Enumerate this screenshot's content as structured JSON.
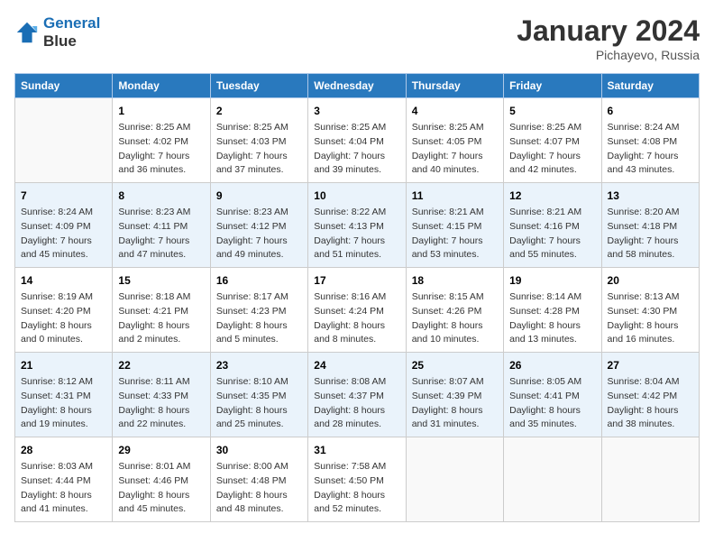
{
  "header": {
    "logo_line1": "General",
    "logo_line2": "Blue",
    "month": "January 2024",
    "location": "Pichayevo, Russia"
  },
  "columns": [
    "Sunday",
    "Monday",
    "Tuesday",
    "Wednesday",
    "Thursday",
    "Friday",
    "Saturday"
  ],
  "weeks": [
    [
      {
        "day": "",
        "info": ""
      },
      {
        "day": "1",
        "info": "Sunrise: 8:25 AM\nSunset: 4:02 PM\nDaylight: 7 hours\nand 36 minutes."
      },
      {
        "day": "2",
        "info": "Sunrise: 8:25 AM\nSunset: 4:03 PM\nDaylight: 7 hours\nand 37 minutes."
      },
      {
        "day": "3",
        "info": "Sunrise: 8:25 AM\nSunset: 4:04 PM\nDaylight: 7 hours\nand 39 minutes."
      },
      {
        "day": "4",
        "info": "Sunrise: 8:25 AM\nSunset: 4:05 PM\nDaylight: 7 hours\nand 40 minutes."
      },
      {
        "day": "5",
        "info": "Sunrise: 8:25 AM\nSunset: 4:07 PM\nDaylight: 7 hours\nand 42 minutes."
      },
      {
        "day": "6",
        "info": "Sunrise: 8:24 AM\nSunset: 4:08 PM\nDaylight: 7 hours\nand 43 minutes."
      }
    ],
    [
      {
        "day": "7",
        "info": "Sunrise: 8:24 AM\nSunset: 4:09 PM\nDaylight: 7 hours\nand 45 minutes."
      },
      {
        "day": "8",
        "info": "Sunrise: 8:23 AM\nSunset: 4:11 PM\nDaylight: 7 hours\nand 47 minutes."
      },
      {
        "day": "9",
        "info": "Sunrise: 8:23 AM\nSunset: 4:12 PM\nDaylight: 7 hours\nand 49 minutes."
      },
      {
        "day": "10",
        "info": "Sunrise: 8:22 AM\nSunset: 4:13 PM\nDaylight: 7 hours\nand 51 minutes."
      },
      {
        "day": "11",
        "info": "Sunrise: 8:21 AM\nSunset: 4:15 PM\nDaylight: 7 hours\nand 53 minutes."
      },
      {
        "day": "12",
        "info": "Sunrise: 8:21 AM\nSunset: 4:16 PM\nDaylight: 7 hours\nand 55 minutes."
      },
      {
        "day": "13",
        "info": "Sunrise: 8:20 AM\nSunset: 4:18 PM\nDaylight: 7 hours\nand 58 minutes."
      }
    ],
    [
      {
        "day": "14",
        "info": "Sunrise: 8:19 AM\nSunset: 4:20 PM\nDaylight: 8 hours\nand 0 minutes."
      },
      {
        "day": "15",
        "info": "Sunrise: 8:18 AM\nSunset: 4:21 PM\nDaylight: 8 hours\nand 2 minutes."
      },
      {
        "day": "16",
        "info": "Sunrise: 8:17 AM\nSunset: 4:23 PM\nDaylight: 8 hours\nand 5 minutes."
      },
      {
        "day": "17",
        "info": "Sunrise: 8:16 AM\nSunset: 4:24 PM\nDaylight: 8 hours\nand 8 minutes."
      },
      {
        "day": "18",
        "info": "Sunrise: 8:15 AM\nSunset: 4:26 PM\nDaylight: 8 hours\nand 10 minutes."
      },
      {
        "day": "19",
        "info": "Sunrise: 8:14 AM\nSunset: 4:28 PM\nDaylight: 8 hours\nand 13 minutes."
      },
      {
        "day": "20",
        "info": "Sunrise: 8:13 AM\nSunset: 4:30 PM\nDaylight: 8 hours\nand 16 minutes."
      }
    ],
    [
      {
        "day": "21",
        "info": "Sunrise: 8:12 AM\nSunset: 4:31 PM\nDaylight: 8 hours\nand 19 minutes."
      },
      {
        "day": "22",
        "info": "Sunrise: 8:11 AM\nSunset: 4:33 PM\nDaylight: 8 hours\nand 22 minutes."
      },
      {
        "day": "23",
        "info": "Sunrise: 8:10 AM\nSunset: 4:35 PM\nDaylight: 8 hours\nand 25 minutes."
      },
      {
        "day": "24",
        "info": "Sunrise: 8:08 AM\nSunset: 4:37 PM\nDaylight: 8 hours\nand 28 minutes."
      },
      {
        "day": "25",
        "info": "Sunrise: 8:07 AM\nSunset: 4:39 PM\nDaylight: 8 hours\nand 31 minutes."
      },
      {
        "day": "26",
        "info": "Sunrise: 8:05 AM\nSunset: 4:41 PM\nDaylight: 8 hours\nand 35 minutes."
      },
      {
        "day": "27",
        "info": "Sunrise: 8:04 AM\nSunset: 4:42 PM\nDaylight: 8 hours\nand 38 minutes."
      }
    ],
    [
      {
        "day": "28",
        "info": "Sunrise: 8:03 AM\nSunset: 4:44 PM\nDaylight: 8 hours\nand 41 minutes."
      },
      {
        "day": "29",
        "info": "Sunrise: 8:01 AM\nSunset: 4:46 PM\nDaylight: 8 hours\nand 45 minutes."
      },
      {
        "day": "30",
        "info": "Sunrise: 8:00 AM\nSunset: 4:48 PM\nDaylight: 8 hours\nand 48 minutes."
      },
      {
        "day": "31",
        "info": "Sunrise: 7:58 AM\nSunset: 4:50 PM\nDaylight: 8 hours\nand 52 minutes."
      },
      {
        "day": "",
        "info": ""
      },
      {
        "day": "",
        "info": ""
      },
      {
        "day": "",
        "info": ""
      }
    ]
  ]
}
